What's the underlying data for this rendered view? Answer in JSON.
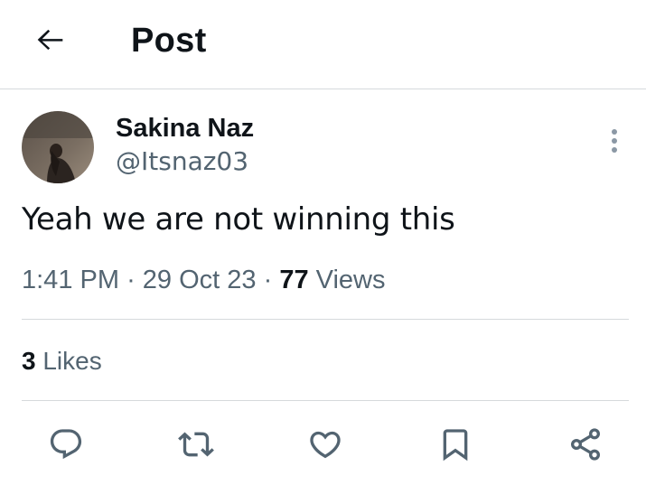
{
  "header": {
    "title": "Post",
    "back_icon": "arrow-left-icon"
  },
  "author": {
    "display_name": "Sakina Naz",
    "handle": "@Itsnaz03"
  },
  "tweet": {
    "text": "Yeah we are not winning this",
    "time": "1:41 PM",
    "date": "29 Oct 23",
    "views_count": "77",
    "views_label": "Views"
  },
  "stats": {
    "likes_count": "3",
    "likes_label": "Likes"
  },
  "actions": {
    "icons": [
      "reply-icon",
      "repost-icon",
      "like-icon",
      "bookmark-icon",
      "share-icon"
    ]
  },
  "colors": {
    "text": "#0f1419",
    "secondary_text": "#536471",
    "divider": "#d6d9dc"
  }
}
